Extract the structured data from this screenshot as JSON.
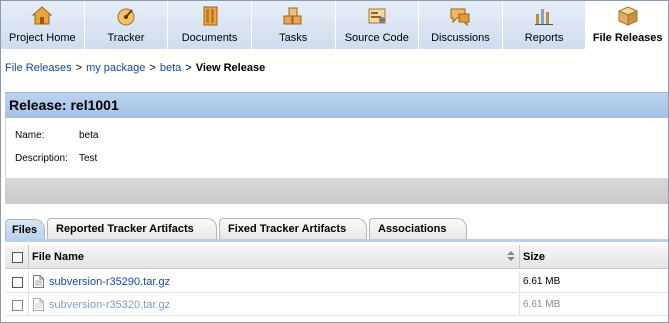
{
  "nav": {
    "tabs": [
      {
        "label": "Project Home",
        "icon": "house-icon"
      },
      {
        "label": "Tracker",
        "icon": "tracker-icon"
      },
      {
        "label": "Documents",
        "icon": "documents-icon"
      },
      {
        "label": "Tasks",
        "icon": "tasks-icon"
      },
      {
        "label": "Source Code",
        "icon": "source-code-icon"
      },
      {
        "label": "Discussions",
        "icon": "discussions-icon"
      },
      {
        "label": "Reports",
        "icon": "reports-icon"
      },
      {
        "label": "File Releases",
        "icon": "file-releases-icon",
        "active": true
      }
    ]
  },
  "breadcrumb": {
    "items": [
      "File Releases",
      "my package",
      "beta"
    ],
    "separator": ">",
    "current": "View Release"
  },
  "release": {
    "title": "Release: rel1001",
    "fields": [
      {
        "label": "Name:",
        "value": "beta"
      },
      {
        "label": "Description:",
        "value": "Test"
      }
    ]
  },
  "subtabs": [
    {
      "label": "Files",
      "active": true
    },
    {
      "label": "Reported Tracker Artifacts"
    },
    {
      "label": "Fixed Tracker Artifacts"
    },
    {
      "label": "Associations"
    }
  ],
  "files_table": {
    "columns": [
      "File Name",
      "Size"
    ],
    "rows": [
      {
        "name": "subversion-r35290.tar.gz",
        "size": "6.61 MB"
      },
      {
        "name": "subversion-r35320.tar.gz",
        "size": "6.61 MB"
      }
    ]
  },
  "colors": {
    "link": "#16489a",
    "header_blue": "#a4c1e6",
    "nav_bg": "#dce6f1"
  }
}
